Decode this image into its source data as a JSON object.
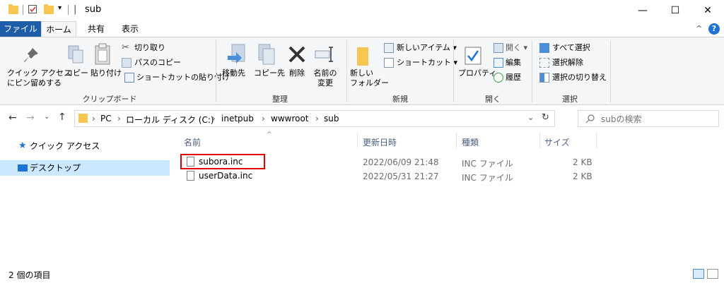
{
  "window": {
    "title": "sub",
    "minimize": "—",
    "maximize": "☐",
    "close": "✕"
  },
  "tabs": {
    "file": "ファイル",
    "home": "ホーム",
    "share": "共有",
    "view": "表示"
  },
  "ribbon": {
    "clipboard": {
      "pin": [
        "クイック アクセス",
        "にピン留めする"
      ],
      "copy": "コピー",
      "paste": "貼り付け",
      "cut": "切り取り",
      "copy_path": "パスのコピー",
      "paste_shortcut": "ショートカットの貼り付け",
      "label": "クリップボード"
    },
    "organize": {
      "move_to": "移動先",
      "copy_to": "コピー先",
      "delete": "削除",
      "rename": [
        "名前の",
        "変更"
      ],
      "label": "整理"
    },
    "new": {
      "new_folder": [
        "新しい",
        "フォルダー"
      ],
      "new_item": "新しいアイテム ▾",
      "easy_access": "ショートカット ▾",
      "label": "新規"
    },
    "open": {
      "properties": "プロパティ",
      "open": "開く ▾",
      "edit": "編集",
      "history": "履歴",
      "label": "開く"
    },
    "select": {
      "select_all": "すべて選択",
      "select_none": "選択解除",
      "invert": "選択の切り替え",
      "label": "選択"
    }
  },
  "address": {
    "crumbs": [
      "PC",
      "ローカル ディスク (C:)",
      "inetpub",
      "wwwroot",
      "sub"
    ],
    "search_placeholder": "subの検索"
  },
  "nav": {
    "quick_access": "クイック アクセス",
    "desktop": "デスクトップ"
  },
  "columns": {
    "name": "名前",
    "modified": "更新日時",
    "type": "種類",
    "size": "サイズ"
  },
  "files": [
    {
      "name": "subora.inc",
      "modified": "2022/06/09 21:48",
      "type": "INC ファイル",
      "size": "2 KB"
    },
    {
      "name": "userData.inc",
      "modified": "2022/05/31 21:27",
      "type": "INC ファイル",
      "size": "2 KB"
    }
  ],
  "status": {
    "count": "2 個の項目"
  },
  "colors": {
    "file_tab": "#1e5ea8",
    "highlight": "#e00000",
    "folder": "#f6c750",
    "nav_selected": "#cce8ff"
  }
}
